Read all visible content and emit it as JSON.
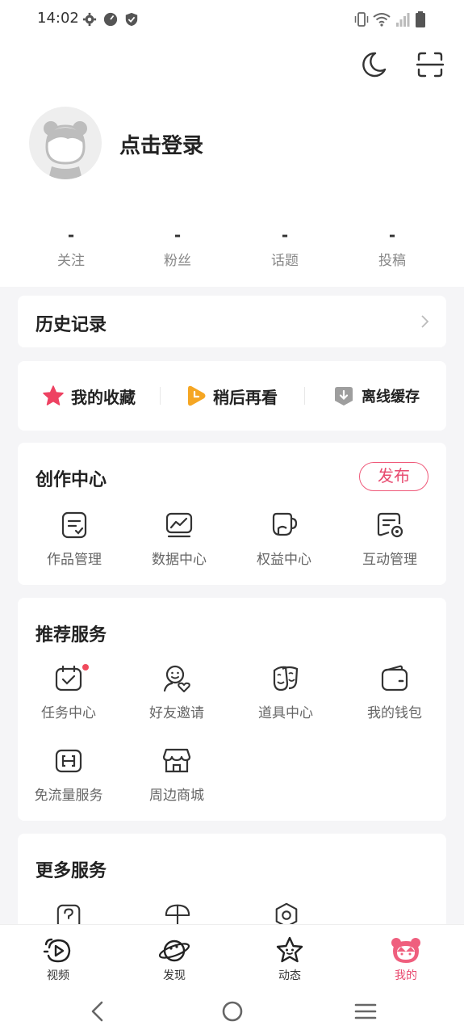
{
  "status": {
    "time": "14:02"
  },
  "profile": {
    "login_text": "点击登录"
  },
  "stats": [
    {
      "value": "-",
      "label": "关注"
    },
    {
      "value": "-",
      "label": "粉丝"
    },
    {
      "value": "-",
      "label": "话题"
    },
    {
      "value": "-",
      "label": "投稿"
    }
  ],
  "history": {
    "title": "历史记录"
  },
  "quick_actions": [
    {
      "label": "我的收藏",
      "icon": "star-icon"
    },
    {
      "label": "稍后再看",
      "icon": "watch-later-icon"
    },
    {
      "label": "离线缓存",
      "icon": "download-icon"
    }
  ],
  "creation": {
    "title": "创作中心",
    "publish_label": "发布",
    "items": [
      {
        "label": "作品管理",
        "icon": "works-icon"
      },
      {
        "label": "数据中心",
        "icon": "data-chart-icon"
      },
      {
        "label": "权益中心",
        "icon": "cup-icon"
      },
      {
        "label": "互动管理",
        "icon": "interaction-icon"
      }
    ]
  },
  "recommended": {
    "title": "推荐服务",
    "items": [
      {
        "label": "任务中心",
        "icon": "calendar-check-icon"
      },
      {
        "label": "好友邀请",
        "icon": "friend-invite-icon"
      },
      {
        "label": "道具中心",
        "icon": "mask-icon"
      },
      {
        "label": "我的钱包",
        "icon": "wallet-icon"
      },
      {
        "label": "免流量服务",
        "icon": "sim-card-icon"
      },
      {
        "label": "周边商城",
        "icon": "store-icon"
      }
    ]
  },
  "more": {
    "title": "更多服务"
  },
  "tabs": [
    {
      "label": "视频",
      "icon": "video-tab-icon"
    },
    {
      "label": "发现",
      "icon": "planet-tab-icon"
    },
    {
      "label": "动态",
      "icon": "star-face-tab-icon"
    },
    {
      "label": "我的",
      "icon": "mine-tab-icon"
    }
  ],
  "colors": {
    "accent": "#e84a6f",
    "star": "#ee4262",
    "later": "#f5a623",
    "download": "#9e9e9e"
  }
}
